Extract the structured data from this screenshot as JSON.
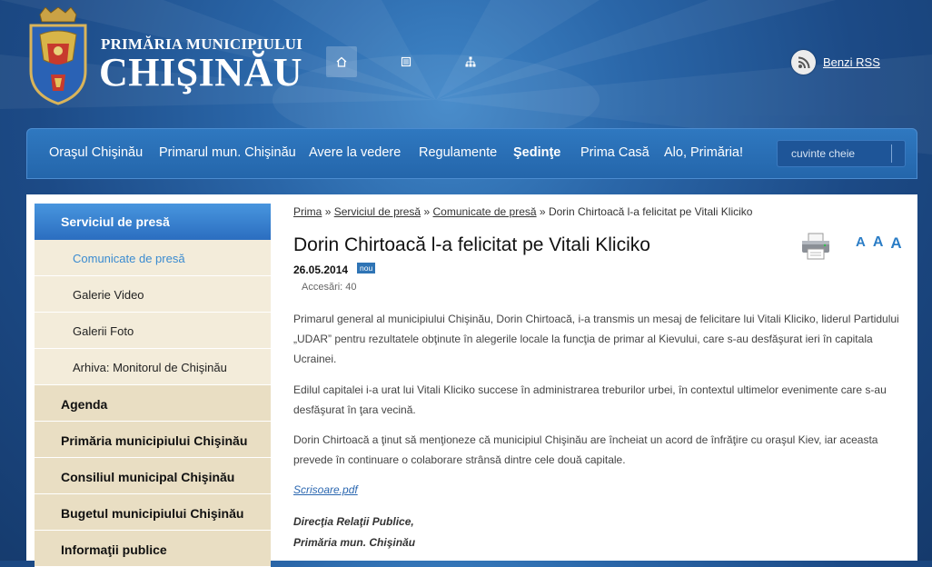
{
  "header": {
    "brand_small": "PRIMĂRIA MUNICIPIULUI",
    "brand_big": "CHIŞINĂU",
    "quick_links": [
      "home-icon",
      "news-icon",
      "sitemap-icon"
    ],
    "rss_label": "Benzi RSS"
  },
  "nav": {
    "items": [
      {
        "label": "Oraşul Chişinău"
      },
      {
        "label": "Primarul mun. Chişinău"
      },
      {
        "label": "Avere la vedere"
      },
      {
        "label": "Regulamente"
      },
      {
        "label": "Şedinţe"
      },
      {
        "label": "Prima Casă"
      },
      {
        "label": "Alo, Primăria!"
      }
    ],
    "search_placeholder": "cuvinte cheie"
  },
  "sidebar": {
    "section": "Serviciul de presă",
    "subitems": [
      {
        "label": "Comunicate de presă"
      },
      {
        "label": "Galerie Video"
      },
      {
        "label": "Galerii Foto"
      },
      {
        "label": "Arhiva: Monitorul de Chişinău"
      }
    ],
    "main_items": [
      {
        "label": "Agenda"
      },
      {
        "label": "Primăria municipiului Chişinău"
      },
      {
        "label": "Consiliul municipal Chişinău"
      },
      {
        "label": "Bugetul municipiului Chişinău"
      },
      {
        "label": "Informaţii publice"
      }
    ]
  },
  "breadcrumb": {
    "items": [
      "Prima",
      "Serviciul de presă",
      "Comunicate de presă"
    ],
    "separator": "»",
    "current": "Dorin Chirtoacă l-a felicitat pe Vitali Kliciko"
  },
  "article": {
    "title": "Dorin Chirtoacă l-a felicitat pe Vitali Kliciko",
    "date": "26.05.2014",
    "badge": "nou",
    "views": "Accesări: 40",
    "font_sizes": [
      "A",
      "A",
      "A"
    ],
    "paragraphs": [
      "Primarul general al municipiului Chişinău, Dorin Chirtoacă, i-a transmis un mesaj de felicitare lui Vitali Kliciko, liderul Partidului „UDAR” pentru rezultatele obţinute în alegerile locale la funcţia de primar al Kievului, care s-au desfăşurat ieri în capitala Ucrainei.",
      "Edilul capitalei i-a urat lui Vitali Kliciko succese în administrarea treburilor urbei, în contextul ultimelor evenimente care s-au desfăşurat în ţara vecină.",
      "Dorin Chirtoacă a ţinut să menţioneze că municipiul Chişinău are încheiat un acord de înfrăţire cu oraşul Kiev, iar aceasta prevede în continuare o colaborare strânsă dintre cele două capitale."
    ],
    "attachment": "Scrisoare.pdf",
    "signature": [
      "Direcţia Relaţii Publice,",
      "Primăria mun. Chişinău"
    ]
  },
  "colors": {
    "background": "#1c4a86",
    "nav": "#2466ab",
    "sidebar_head": "#2b6ec0",
    "sidebar_sub": "#f3ecda",
    "sidebar_main": "#e9dec3",
    "link": "#2b7dc6"
  }
}
